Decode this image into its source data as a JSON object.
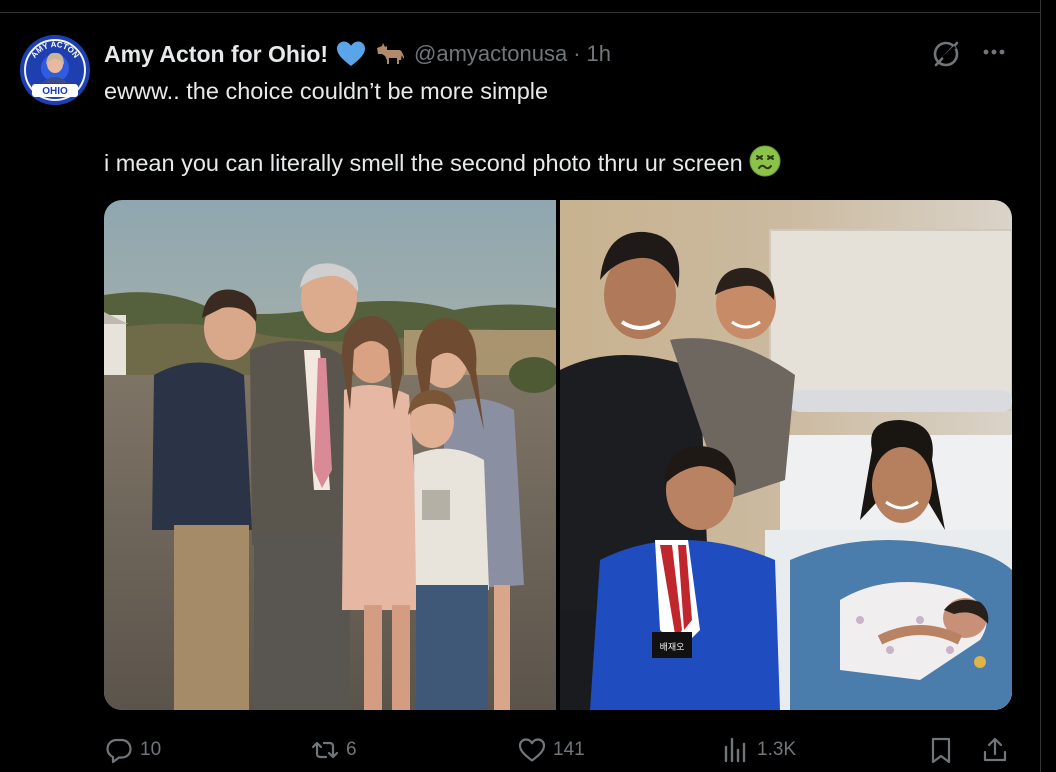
{
  "post": {
    "author": {
      "display_name": "Amy Acton for Ohio!",
      "handle": "@amyactonusa",
      "separator": "·",
      "time": "1h",
      "avatar_text_top": "AMY ACTON",
      "avatar_text_bottom": "OHIO",
      "badge_icon": "blue-heart-icon",
      "party_icon": "donkey-icon"
    },
    "text": {
      "line1": "ewww.. the choice couldn’t be more simple",
      "line2": "i mean you can literally smell the second photo thru ur screen",
      "emoji": "nauseated-face-emoji"
    },
    "media": {
      "photo_left_icon": "family-photo-outdoors",
      "photo_right_icon": "family-photo-hospital",
      "right_photo_patch_text": "배재오"
    },
    "header_icons": [
      "grok-icon",
      "more-icon"
    ],
    "actions": {
      "replies": "10",
      "reposts": "6",
      "likes": "141",
      "views": "1.3K"
    },
    "colors": {
      "background": "#000000",
      "text": "#e7e9ea",
      "muted": "#71767b",
      "heart": "#5aa5e8",
      "avatar": "#1d3fb0"
    }
  }
}
